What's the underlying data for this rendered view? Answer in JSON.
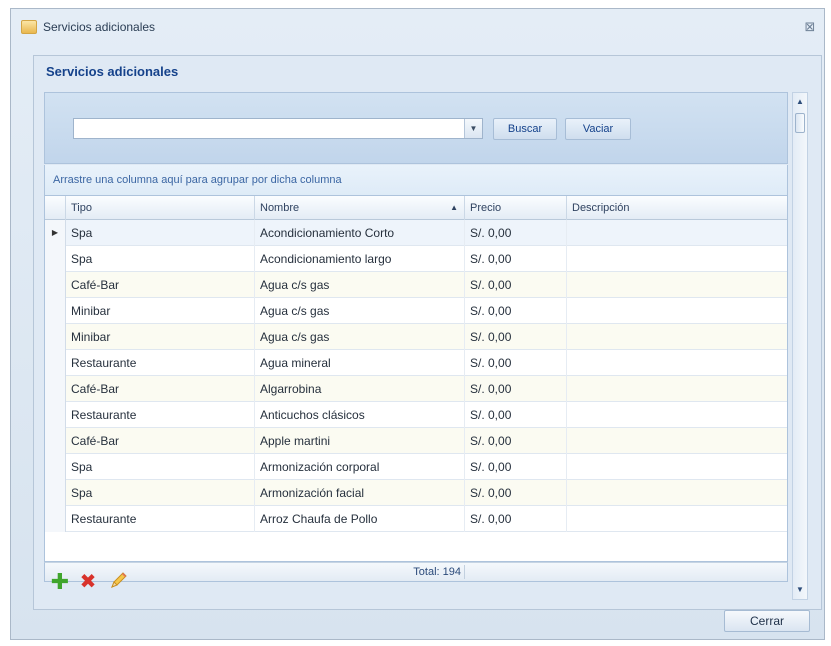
{
  "window": {
    "title": "Servicios adicionales",
    "close_glyph": "⊠"
  },
  "group": {
    "title": "Servicios adicionales"
  },
  "search": {
    "value": "",
    "placeholder": ""
  },
  "toolbar": {
    "search_label": "Buscar",
    "clear_label": "Vaciar"
  },
  "grouping_panel": {
    "text": "Arrastre una columna aquí para agrupar por dicha columna"
  },
  "grid": {
    "columns": {
      "tipo": "Tipo",
      "nombre": "Nombre",
      "precio": "Precio",
      "descripcion": "Descripción"
    },
    "sorted_column": "Nombre",
    "sort_direction": "ascending",
    "rows": [
      {
        "tipo": "Spa",
        "nombre": "Acondicionamiento Corto",
        "precio": "S/. 0,00",
        "descripcion": ""
      },
      {
        "tipo": "Spa",
        "nombre": "Acondicionamiento largo",
        "precio": "S/. 0,00",
        "descripcion": ""
      },
      {
        "tipo": "Café-Bar",
        "nombre": "Agua c/s gas",
        "precio": "S/. 0,00",
        "descripcion": ""
      },
      {
        "tipo": "Minibar",
        "nombre": "Agua c/s gas",
        "precio": "S/. 0,00",
        "descripcion": ""
      },
      {
        "tipo": "Minibar",
        "nombre": "Agua c/s gas",
        "precio": "S/. 0,00",
        "descripcion": ""
      },
      {
        "tipo": "Restaurante",
        "nombre": "Agua mineral",
        "precio": "S/. 0,00",
        "descripcion": ""
      },
      {
        "tipo": "Café-Bar",
        "nombre": "Algarrobina",
        "precio": "S/. 0,00",
        "descripcion": ""
      },
      {
        "tipo": "Restaurante",
        "nombre": "Anticuchos clásicos",
        "precio": "S/. 0,00",
        "descripcion": ""
      },
      {
        "tipo": "Café-Bar",
        "nombre": "Apple martini",
        "precio": "S/. 0,00",
        "descripcion": ""
      },
      {
        "tipo": "Spa",
        "nombre": "Armonización corporal",
        "precio": "S/. 0,00",
        "descripcion": ""
      },
      {
        "tipo": "Spa",
        "nombre": "Armonización facial",
        "precio": "S/. 0,00",
        "descripcion": ""
      },
      {
        "tipo": "Restaurante",
        "nombre": "Arroz Chaufa de Pollo",
        "precio": "S/. 0,00",
        "descripcion": ""
      }
    ],
    "total_label": "Total: 194"
  },
  "actions": {
    "add_icon": "plus-icon",
    "delete_icon": "delete-icon",
    "edit_icon": "pencil-icon"
  },
  "footer": {
    "close_label": "Cerrar"
  },
  "colors": {
    "title_blue": "#15428b",
    "panel_bg": "#dfe9f4",
    "add_green": "#3fa52c",
    "delete_red": "#d8322b"
  }
}
